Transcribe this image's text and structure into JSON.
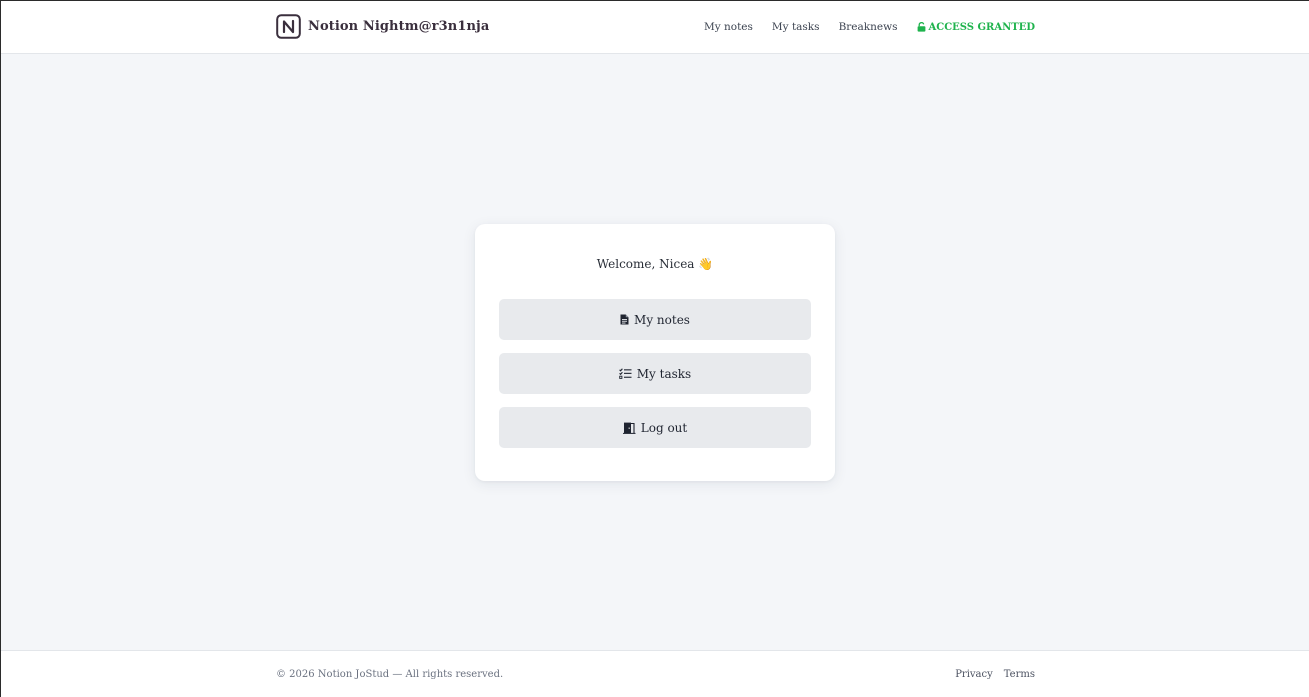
{
  "header": {
    "brand_name": "Notion Nightm@r3n1nja",
    "logo_icon": "notion-n-icon",
    "nav": {
      "my_notes": "My notes",
      "my_tasks": "My tasks",
      "breaknews": "Breaknews",
      "access": "ACCESS GRANTED",
      "access_icon": "unlock-icon"
    }
  },
  "card": {
    "welcome": "Welcome, Nicea 👋",
    "buttons": {
      "notes": {
        "label": "My notes",
        "icon": "file-icon"
      },
      "tasks": {
        "label": "My tasks",
        "icon": "checklist-icon"
      },
      "logout": {
        "label": "Log out",
        "icon": "door-exit-icon"
      }
    }
  },
  "footer": {
    "copyright": "© 2026 Notion JoStud — All rights reserved.",
    "privacy": "Privacy",
    "terms": "Terms"
  },
  "colors": {
    "background": "#f4f6f9",
    "access_green": "#1fb34d",
    "button_bg": "#e8eaed",
    "brand_text": "#3a2f3d"
  }
}
